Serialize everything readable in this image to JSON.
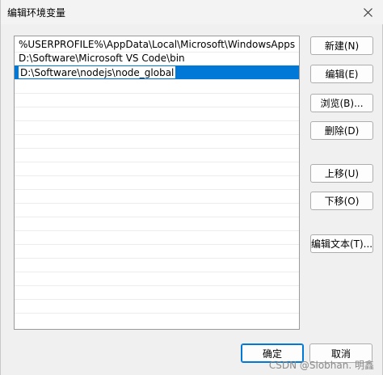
{
  "window": {
    "title": "编辑环境变量",
    "close_icon": "close-icon"
  },
  "paths": [
    "%USERPROFILE%\\AppData\\Local\\Microsoft\\WindowsApps",
    "D:\\Software\\Microsoft VS Code\\bin",
    "D:\\Software\\nodejs\\node_global"
  ],
  "buttons": {
    "new": "新建(N)",
    "edit": "编辑(E)",
    "browse": "浏览(B)...",
    "delete": "删除(D)",
    "move_up": "上移(U)",
    "move_down": "下移(O)",
    "edit_text": "编辑文本(T)...",
    "ok": "确定",
    "cancel": "取消"
  },
  "watermark": "CSDN @Slobhan. 明鑫",
  "colors": {
    "selection": "#0078d7",
    "dialog_bg": "#f0f0f0"
  }
}
